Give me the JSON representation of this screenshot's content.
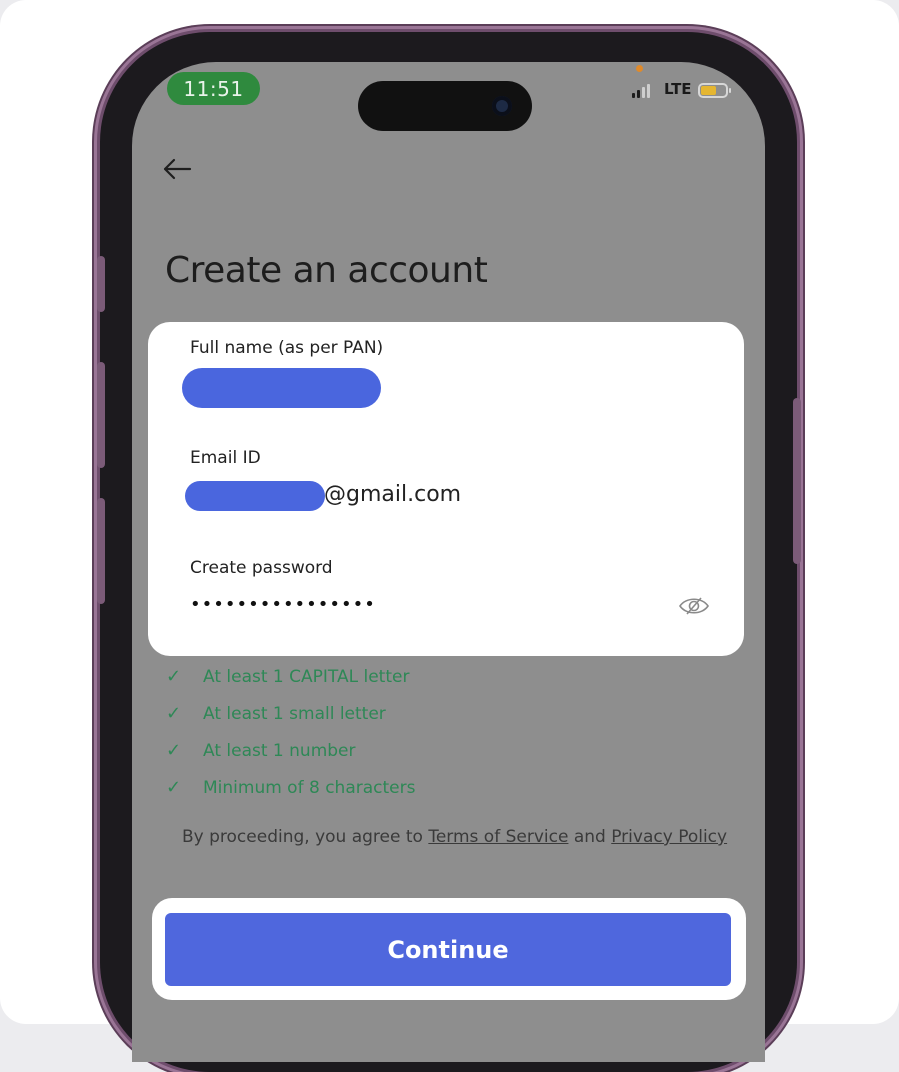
{
  "status_bar": {
    "time": "11:51",
    "network": "LTE"
  },
  "header": {
    "back_icon": "arrow-left-icon",
    "title": "Create an account"
  },
  "form": {
    "full_name": {
      "label": "Full name (as per PAN)",
      "value_redacted": true
    },
    "email": {
      "label": "Email ID",
      "value_suffix": "@gmail.com",
      "value_redacted": true
    },
    "password": {
      "label": "Create password",
      "value": "••••••••••••••••",
      "toggle_icon": "eye-off-icon"
    }
  },
  "password_rules": [
    {
      "text": "At least 1 CAPITAL letter"
    },
    {
      "text": "At least 1 small letter"
    },
    {
      "text": "At least 1 number"
    },
    {
      "text": "Minimum of 8 characters"
    }
  ],
  "legal": {
    "prefix": "By proceeding, you agree to ",
    "terms": "Terms of Service",
    "and": " and ",
    "privacy": "Privacy Policy"
  },
  "continue_label": "Continue",
  "colors": {
    "primary": "#4f67dd",
    "rule_green": "#2e8856",
    "redaction": "#4a66de",
    "time_pill": "#2f8a3e"
  }
}
